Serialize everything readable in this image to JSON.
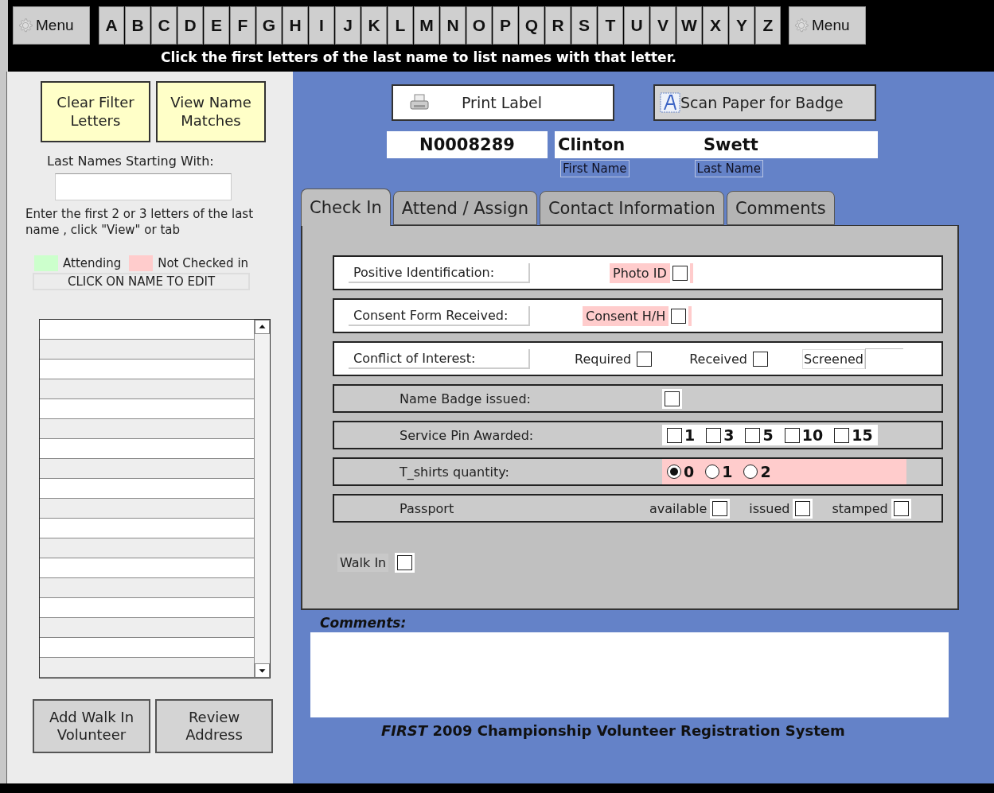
{
  "toolbar": {
    "menu_buttons": [
      "Menu",
      "Menu"
    ],
    "letters": [
      "A",
      "B",
      "C",
      "D",
      "E",
      "F",
      "G",
      "H",
      "I",
      "J",
      "K",
      "L",
      "M",
      "N",
      "O",
      "P",
      "Q",
      "R",
      "S",
      "T",
      "U",
      "V",
      "W",
      "X",
      "Y",
      "Z"
    ],
    "hint": "Click the first letters of the last name to  list names with that letter."
  },
  "sidebar": {
    "buttons": [
      "Clear Filter Letters",
      "View Name Matches"
    ],
    "search_label": "Last Names Starting With:",
    "instructions": "Enter the first 2 or 3 letters of the last name , click \"View\" or tab",
    "legend": [
      {
        "label": "Attending",
        "color": "#ccffcc"
      },
      {
        "label": "Not Checked in",
        "color": "#ffcccc"
      }
    ],
    "list_header": "CLICK ON NAME TO EDIT",
    "bottom_buttons": [
      "Add Walk In Volunteer",
      "Review Address"
    ]
  },
  "record": {
    "buttons": [
      {
        "label": "Print Label",
        "kind": "print"
      },
      {
        "label": "Scan Paper for Badge",
        "kind": "scan"
      }
    ],
    "id": "N0008289",
    "first_name": "Clinton",
    "last_name": "Swett",
    "first_name_label": "First Name",
    "last_name_label": "Last Name"
  },
  "tabs": [
    {
      "label": "Check In",
      "selected": true
    },
    {
      "label": "Attend / Assign",
      "selected": false
    },
    {
      "label": "Contact Information",
      "selected": false
    },
    {
      "label": "Comments",
      "selected": false
    }
  ],
  "check_in": {
    "rows": [
      {
        "label": "Positive Identification:",
        "flagged": false,
        "controls": [
          {
            "kind": "checkbox",
            "label": "Photo ID",
            "checked": false,
            "flagged": true
          }
        ]
      },
      {
        "label": "Consent Form Received:",
        "flagged": false,
        "controls": [
          {
            "kind": "checkbox",
            "label": "Consent H/H",
            "checked": false,
            "flagged": true
          }
        ]
      },
      {
        "label": "Conflict of Interest:",
        "flagged": false,
        "controls": [
          {
            "kind": "checkbox",
            "label": "Required",
            "checked": false,
            "flagged": false
          },
          {
            "kind": "checkbox",
            "label": "Received",
            "checked": false,
            "flagged": false
          },
          {
            "kind": "field",
            "label": "Screened"
          }
        ]
      },
      {
        "label": "Name Badge issued:",
        "flagged": false,
        "controls": [
          {
            "kind": "checkbox",
            "checked": false
          }
        ]
      },
      {
        "label": "Service Pin Awarded:",
        "flagged": false,
        "controls": [
          {
            "kind": "pin",
            "label": "1",
            "checked": false
          },
          {
            "kind": "pin",
            "label": "3",
            "checked": false
          },
          {
            "kind": "pin",
            "label": "5",
            "checked": false
          },
          {
            "kind": "pin",
            "label": "10",
            "checked": false
          },
          {
            "kind": "pin",
            "label": "15",
            "checked": false
          }
        ]
      },
      {
        "label": "T_shirts quantity:",
        "flagged": true,
        "controls": [
          {
            "kind": "radio",
            "label": "0",
            "selected": true
          },
          {
            "kind": "radio",
            "label": "1",
            "selected": false
          },
          {
            "kind": "radio",
            "label": "2",
            "selected": false
          }
        ]
      },
      {
        "label": "Passport",
        "flagged": false,
        "controls": [
          {
            "kind": "checkbox",
            "label": "available",
            "checked": false,
            "flagged": false
          },
          {
            "kind": "checkbox",
            "label": "issued",
            "checked": false,
            "flagged": false
          },
          {
            "kind": "checkbox",
            "label": "stamped",
            "checked": false,
            "flagged": false
          }
        ]
      }
    ],
    "walk_in": {
      "label": "Walk In",
      "checked": false
    }
  },
  "comments": {
    "label": "Comments:"
  },
  "footer": "*FIRST* 2009 Championship Volunteer Registration System"
}
